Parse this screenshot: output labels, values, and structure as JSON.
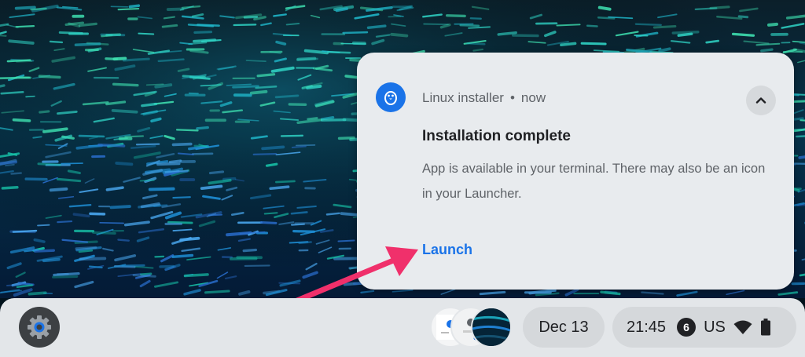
{
  "notification": {
    "app_name": "Linux installer",
    "separator": "•",
    "time": "now",
    "title": "Installation complete",
    "body": "App is available in your terminal. There may also be an icon in your Launcher.",
    "action_label": "Launch",
    "icons": {
      "app": "linux-penguin-icon",
      "collapse": "chevron-up-icon"
    }
  },
  "shelf": {
    "launcher_icon": "gear-icon",
    "date": "Dec 13",
    "time": "21:45",
    "notification_count": "6",
    "input_method": "US",
    "status_icons": [
      "wifi-icon",
      "battery-icon"
    ]
  },
  "colors": {
    "accent": "#1a73e8",
    "annotation_arrow": "#f0306b",
    "card_background": "#e8ebee",
    "shelf_background": "#e3e6e9"
  }
}
